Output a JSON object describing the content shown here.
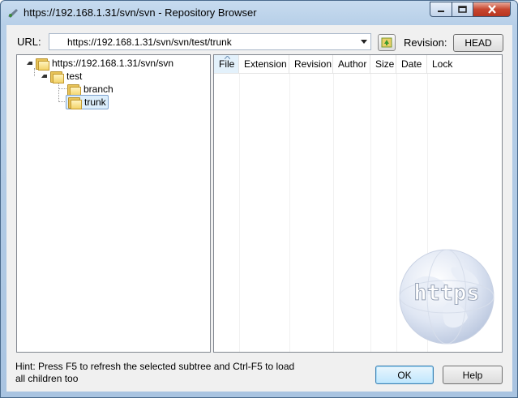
{
  "window": {
    "title": "https://192.168.1.31/svn/svn - Repository Browser"
  },
  "toolbar": {
    "url_label": "URL:",
    "url_value": "https://192.168.1.31/svn/svn/test/trunk",
    "revision_label": "Revision:",
    "revision_button": "HEAD"
  },
  "tree": {
    "root": "https://192.168.1.31/svn/svn",
    "nodes": [
      {
        "label": "test"
      },
      {
        "label": "branch"
      },
      {
        "label": "trunk",
        "selected": true
      }
    ]
  },
  "list": {
    "columns": [
      "File",
      "Extension",
      "Revision",
      "Author",
      "Size",
      "Date",
      "Lock"
    ],
    "watermark": "https"
  },
  "footer": {
    "hint": "Hint: Press F5 to refresh the selected subtree and Ctrl-F5 to load all children too",
    "ok_label": "OK",
    "help_label": "Help"
  }
}
